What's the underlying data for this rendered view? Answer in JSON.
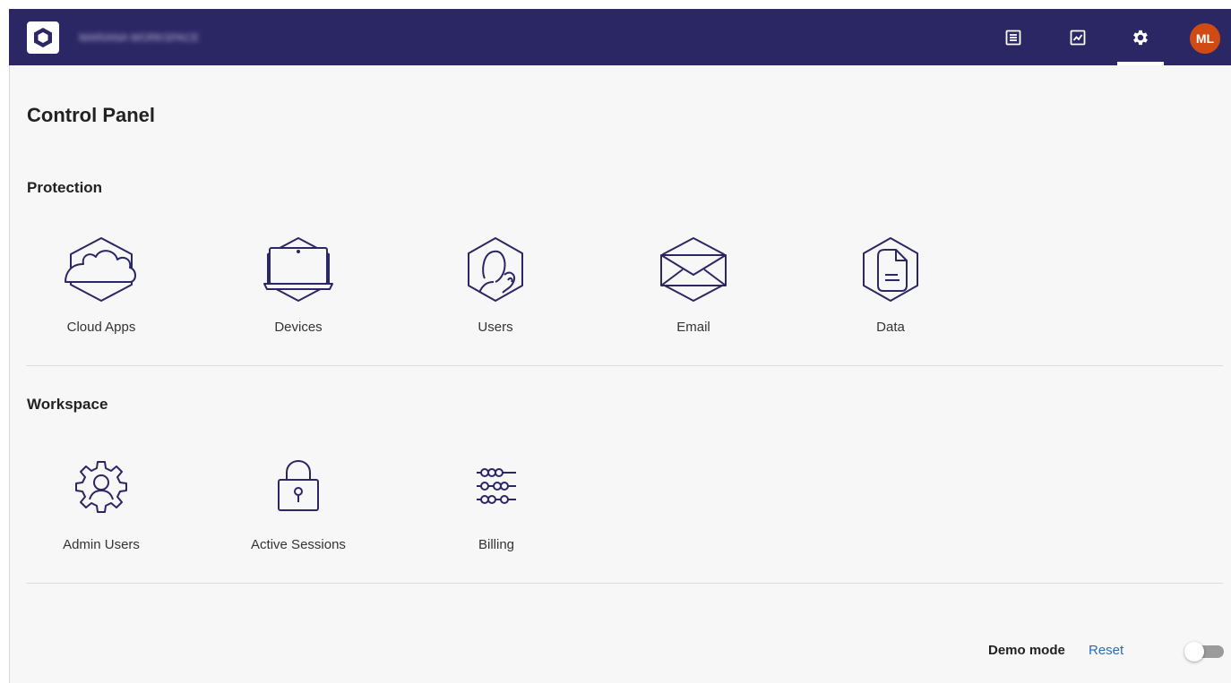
{
  "header": {
    "workspace_name": "MARIANA WORKSPACE",
    "nav": [
      {
        "name": "logs-icon"
      },
      {
        "name": "reports-icon"
      },
      {
        "name": "settings-icon",
        "active": true
      }
    ],
    "avatar_initials": "ML",
    "colors": {
      "bar": "#2b2664",
      "avatar": "#d04a14"
    }
  },
  "page": {
    "title": "Control Panel"
  },
  "protection": {
    "title": "Protection",
    "tiles": [
      {
        "label": "Cloud Apps",
        "icon": "cloud-icon"
      },
      {
        "label": "Devices",
        "icon": "laptop-icon"
      },
      {
        "label": "Users",
        "icon": "user-icon"
      },
      {
        "label": "Email",
        "icon": "envelope-icon"
      },
      {
        "label": "Data",
        "icon": "document-icon"
      }
    ]
  },
  "workspace": {
    "title": "Workspace",
    "tiles": [
      {
        "label": "Admin Users",
        "icon": "admin-gear-icon"
      },
      {
        "label": "Active Sessions",
        "icon": "lock-icon"
      },
      {
        "label": "Billing",
        "icon": "abacus-icon"
      }
    ]
  },
  "footer": {
    "demo_mode_label": "Demo mode",
    "reset_label": "Reset",
    "demo_mode_on": false
  },
  "accent_color": "#2c6bb8",
  "icon_color": "#2b2664"
}
